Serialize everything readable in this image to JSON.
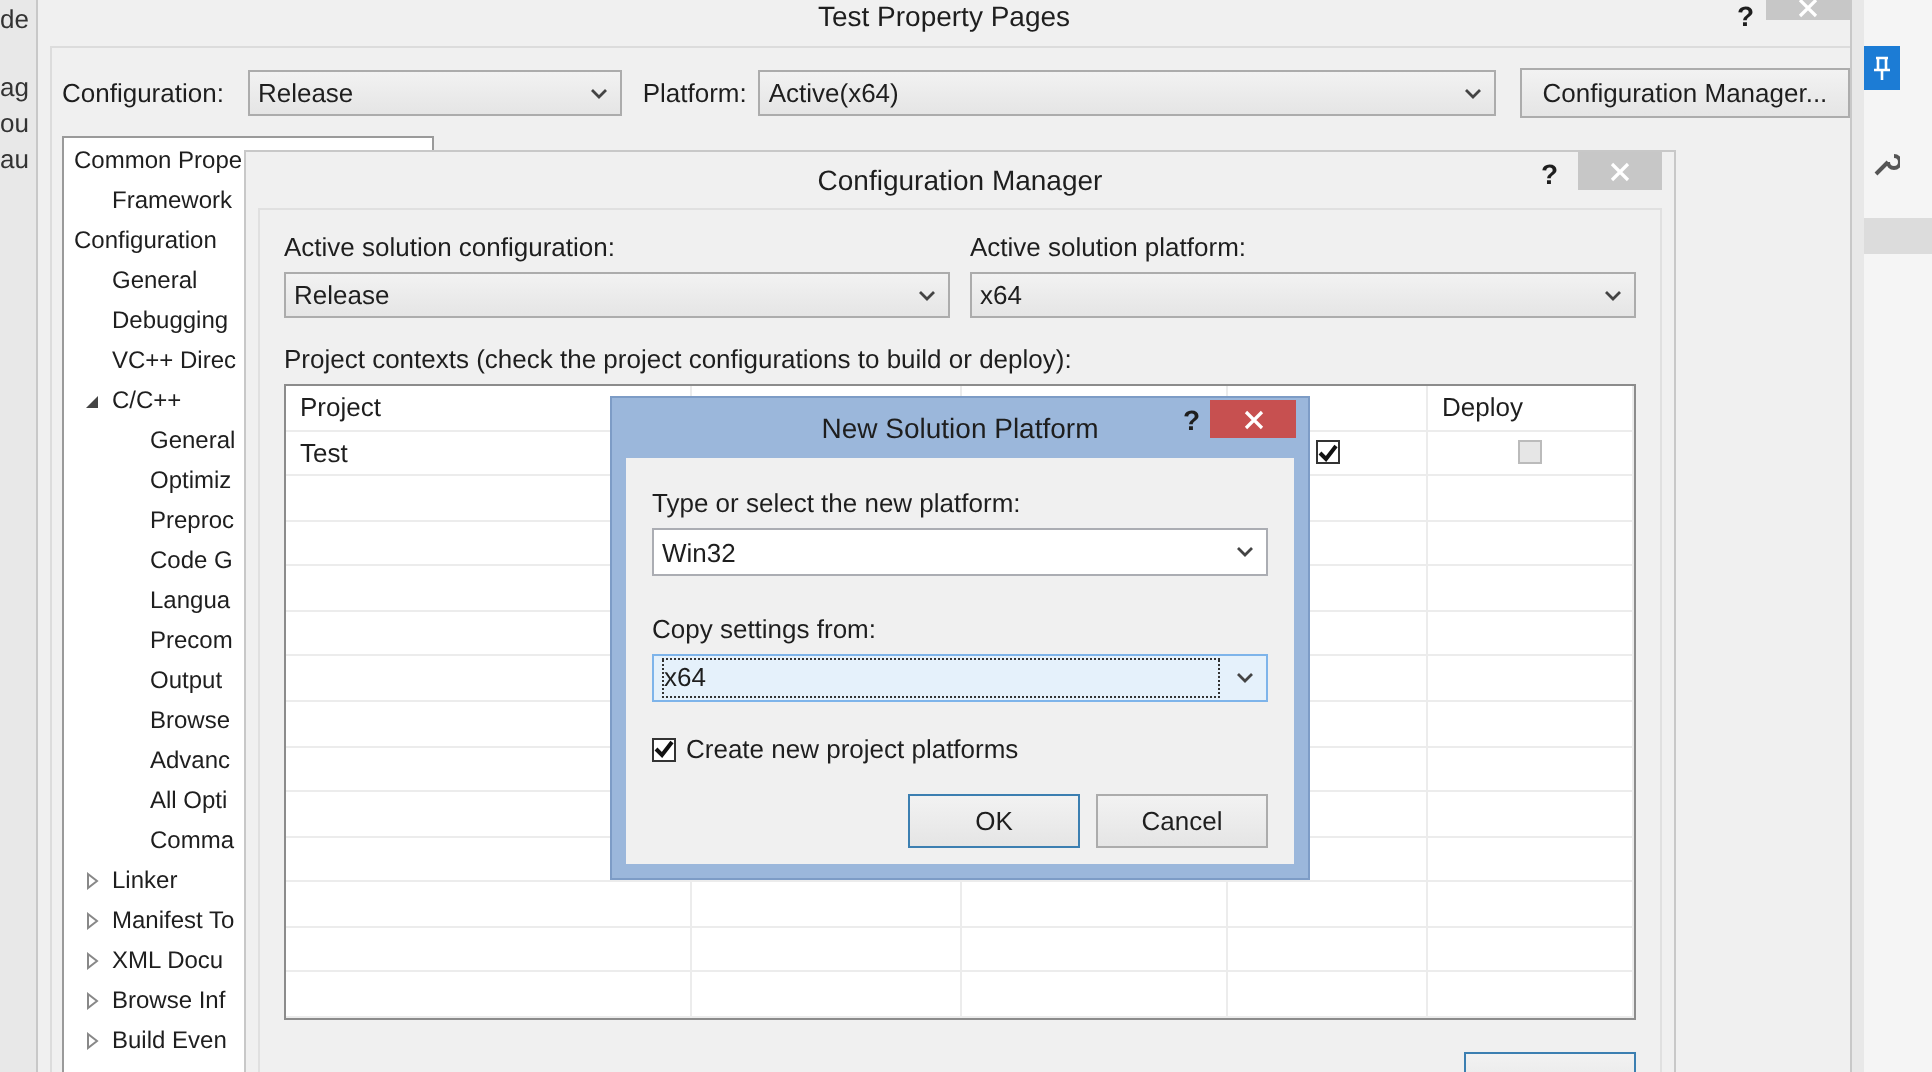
{
  "background_fragments": [
    "de",
    "ag",
    "ou",
    "au"
  ],
  "property_window": {
    "title": "Test Property Pages",
    "help": "?",
    "configuration_label": "Configuration:",
    "configuration": "Release",
    "platform_label": "Platform:",
    "platform": "Active(x64)",
    "manager_button": "Configuration Manager...",
    "tree": [
      {
        "label": "Common Prope",
        "children": [
          {
            "label": "Framework"
          }
        ]
      },
      {
        "label": "Configuration",
        "children": [
          {
            "label": "General"
          },
          {
            "label": "Debugging"
          },
          {
            "label": "VC++ Direc"
          },
          {
            "label": "C/C++",
            "expanded": true,
            "children": [
              {
                "label": "General"
              },
              {
                "label": "Optimiz"
              },
              {
                "label": "Preproc"
              },
              {
                "label": "Code G"
              },
              {
                "label": "Langua"
              },
              {
                "label": "Precom"
              },
              {
                "label": "Output"
              },
              {
                "label": "Browse"
              },
              {
                "label": "Advanc"
              },
              {
                "label": "All Opti"
              },
              {
                "label": "Comma"
              }
            ]
          },
          {
            "label": "Linker",
            "expanded": false
          },
          {
            "label": "Manifest To",
            "expanded": false
          },
          {
            "label": "XML Docu",
            "expanded": false
          },
          {
            "label": "Browse Inf",
            "expanded": false
          },
          {
            "label": "Build Even",
            "expanded": false
          }
        ]
      }
    ]
  },
  "configuration_manager": {
    "title": "Configuration Manager",
    "help": "?",
    "active_config_label": "Active solution configuration:",
    "active_config": "Release",
    "active_platform_label": "Active solution platform:",
    "active_platform": "x64",
    "contexts_label": "Project contexts (check the project configurations to build or deploy):",
    "columns": [
      {
        "label": "Project"
      },
      {},
      {},
      {},
      {
        "label": "Deploy"
      }
    ],
    "rows": [
      {
        "project": "Test",
        "build": true,
        "deploy": false,
        "deploy_disabled": true
      }
    ]
  },
  "new_platform_dialog": {
    "title": "New Solution Platform",
    "help": "?",
    "platform_label": "Type or select the new platform:",
    "platform": "Win32",
    "copy_label": "Copy settings from:",
    "copy_from": "x64",
    "create_label": "Create new project platforms",
    "create_checked": true,
    "buttons": [
      {
        "label": "OK",
        "default": true
      },
      {
        "label": "Cancel",
        "default": false
      }
    ]
  }
}
